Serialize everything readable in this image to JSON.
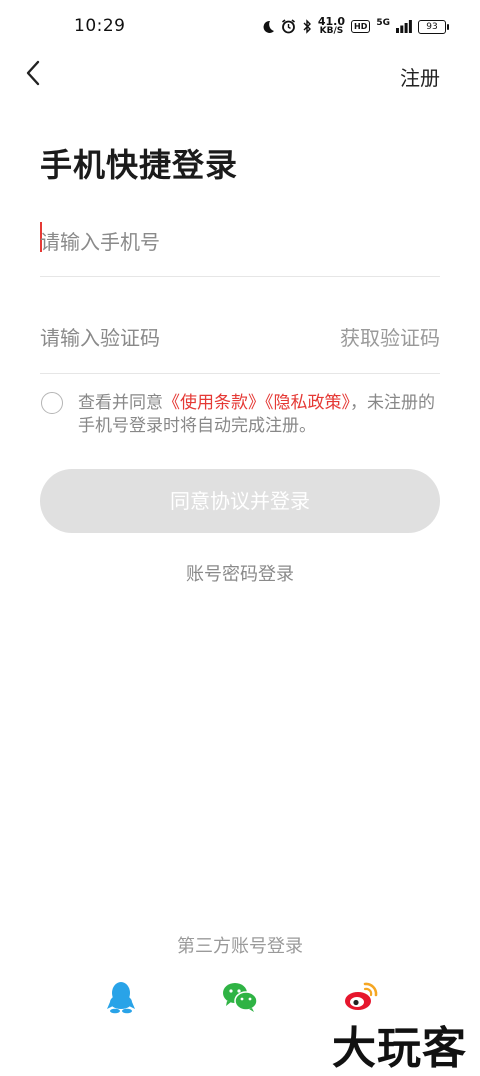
{
  "status_bar": {
    "time": "10:29",
    "net_speed_value": "41.0",
    "net_speed_unit": "KB/S",
    "hd_label": "HD",
    "network": "5G",
    "battery": "93"
  },
  "header": {
    "back_icon": "chevron-left-icon",
    "register_label": "注册"
  },
  "page_title": "手机快捷登录",
  "phone_input": {
    "placeholder": "请输入手机号"
  },
  "code_input": {
    "placeholder": "请输入验证码",
    "get_code_label": "获取验证码"
  },
  "agreement": {
    "prefix": "查看并同意",
    "terms": "《使用条款》",
    "privacy": "《隐私政策》",
    "suffix": "，未注册的手机号登录时将自动完成注册。"
  },
  "login_button": "同意协议并登录",
  "password_login": "账号密码登录",
  "third_party": {
    "title": "第三方账号登录",
    "icons": [
      "qq-icon",
      "wechat-icon",
      "weibo-icon"
    ]
  },
  "watermark": "大玩客",
  "colors": {
    "accent_red": "#e53935",
    "disabled_button": "#e0e0e0",
    "qq_blue": "#29a3e8",
    "wechat_green": "#2fb344",
    "weibo_red": "#e6162d"
  }
}
